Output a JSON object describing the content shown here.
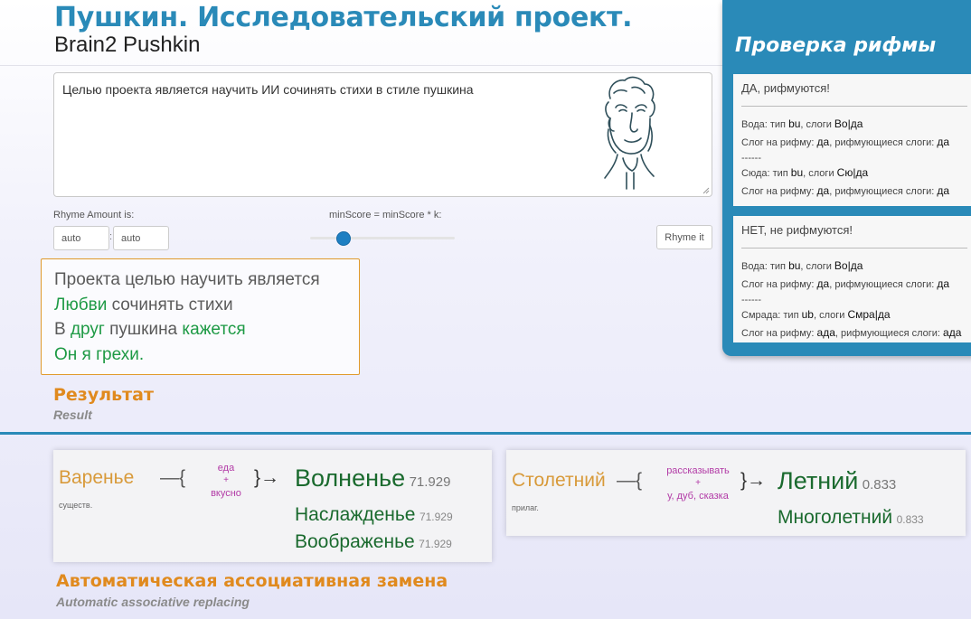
{
  "header": {
    "title": "Пушкин. Исследовательский проект.",
    "subtitle": "Brain2 Pushkin"
  },
  "input": {
    "text": "Целью проекта является научить ИИ сочинять стихи в стиле пушкина"
  },
  "controls": {
    "rhyme_amount_label": "Rhyme Amount is:",
    "rhyme_min_value": "auto",
    "rhyme_separator": ":",
    "rhyme_max_value": "auto",
    "min_score_label": "minScore = minScore * k:",
    "min_score_slider_fraction": 0.23,
    "rhyme_button_label": "Rhyme it"
  },
  "poem": {
    "lines": [
      {
        "parts": [
          {
            "text": "Проекта целью научить является",
            "style": "gray"
          }
        ]
      },
      {
        "parts": [
          {
            "text": "Любви",
            "style": "green"
          },
          {
            "text": " сочинять стихи",
            "style": "gray"
          }
        ]
      },
      {
        "parts": [
          {
            "text": "В ",
            "style": "gray"
          },
          {
            "text": "друг",
            "style": "green"
          },
          {
            "text": " пушкина ",
            "style": "gray"
          },
          {
            "text": "кажется",
            "style": "green"
          }
        ]
      },
      {
        "parts": [
          {
            "text": "Он я грехи.",
            "style": "green"
          }
        ]
      }
    ]
  },
  "result": {
    "label": "Результат",
    "sublabel": "Result"
  },
  "rhyme_check": {
    "title": "Проверка рифмы",
    "cards": [
      {
        "verdict": "ДА, рифмуются!",
        "word1": {
          "pre": "Вода: тип ",
          "type": "bu",
          "mid": ", слоги ",
          "syllables": "Во|да"
        },
        "line1": {
          "pre": "Слог на рифму: ",
          "syl": "да",
          "mid": ", рифмующиеся слоги: ",
          "rhyme": "да"
        },
        "separator": "------",
        "word2": {
          "pre": "Сюда: тип ",
          "type": "bu",
          "mid": ", слоги ",
          "syllables": "Сю|да"
        },
        "line2": {
          "pre": "Слог на рифму: ",
          "syl": "да",
          "mid": ", рифмующиеся слоги: ",
          "rhyme": "да"
        }
      },
      {
        "verdict": "НЕТ, не рифмуются!",
        "word1": {
          "pre": "Вода: тип ",
          "type": "bu",
          "mid": ", слоги ",
          "syllables": "Во|да"
        },
        "line1": {
          "pre": "Слог на рифму: ",
          "syl": "да",
          "mid": ", рифмующиеся слоги: ",
          "rhyme": "да"
        },
        "separator": "------",
        "word2": {
          "pre": "Смрада: тип ",
          "type": "ub",
          "mid": ", слоги ",
          "syllables": "Смра|да"
        },
        "line2": {
          "pre": "Слог на рифму: ",
          "syl": "ада",
          "mid": ", рифмующиеся слоги: ",
          "rhyme": "ада"
        }
      }
    ]
  },
  "assoc": {
    "card1": {
      "source": "Варенье",
      "pos": "существ.",
      "brace_open": "—{",
      "hint_top": "еда",
      "hint_plus": "+",
      "hint_bottom": "вкусно",
      "brace_close": "}→",
      "main_word": "Волненье",
      "main_score": "71.929",
      "alts": [
        {
          "word": "Наслажденье",
          "score": "71.929"
        },
        {
          "word": "Воображенье",
          "score": "71.929"
        }
      ]
    },
    "card2": {
      "source": "Столетний",
      "pos": "прилаг.",
      "brace_open": "—{",
      "hint_top": "рассказывать",
      "hint_plus": "+",
      "hint_bottom": "у, дуб, сказка",
      "brace_close": "}→",
      "main_word": "Летний",
      "main_score": "0.833",
      "alts": [
        {
          "word": "Многолетний",
          "score": "0.833"
        }
      ]
    },
    "label": "Автоматическая ассоциативная замена",
    "sublabel": "Automatic associative replacing"
  },
  "colors": {
    "brand_blue": "#2a8ab8",
    "accent_orange": "#e08a1e",
    "rhyme_green": "#1e9a45",
    "hint_magenta": "#b23aa6"
  }
}
